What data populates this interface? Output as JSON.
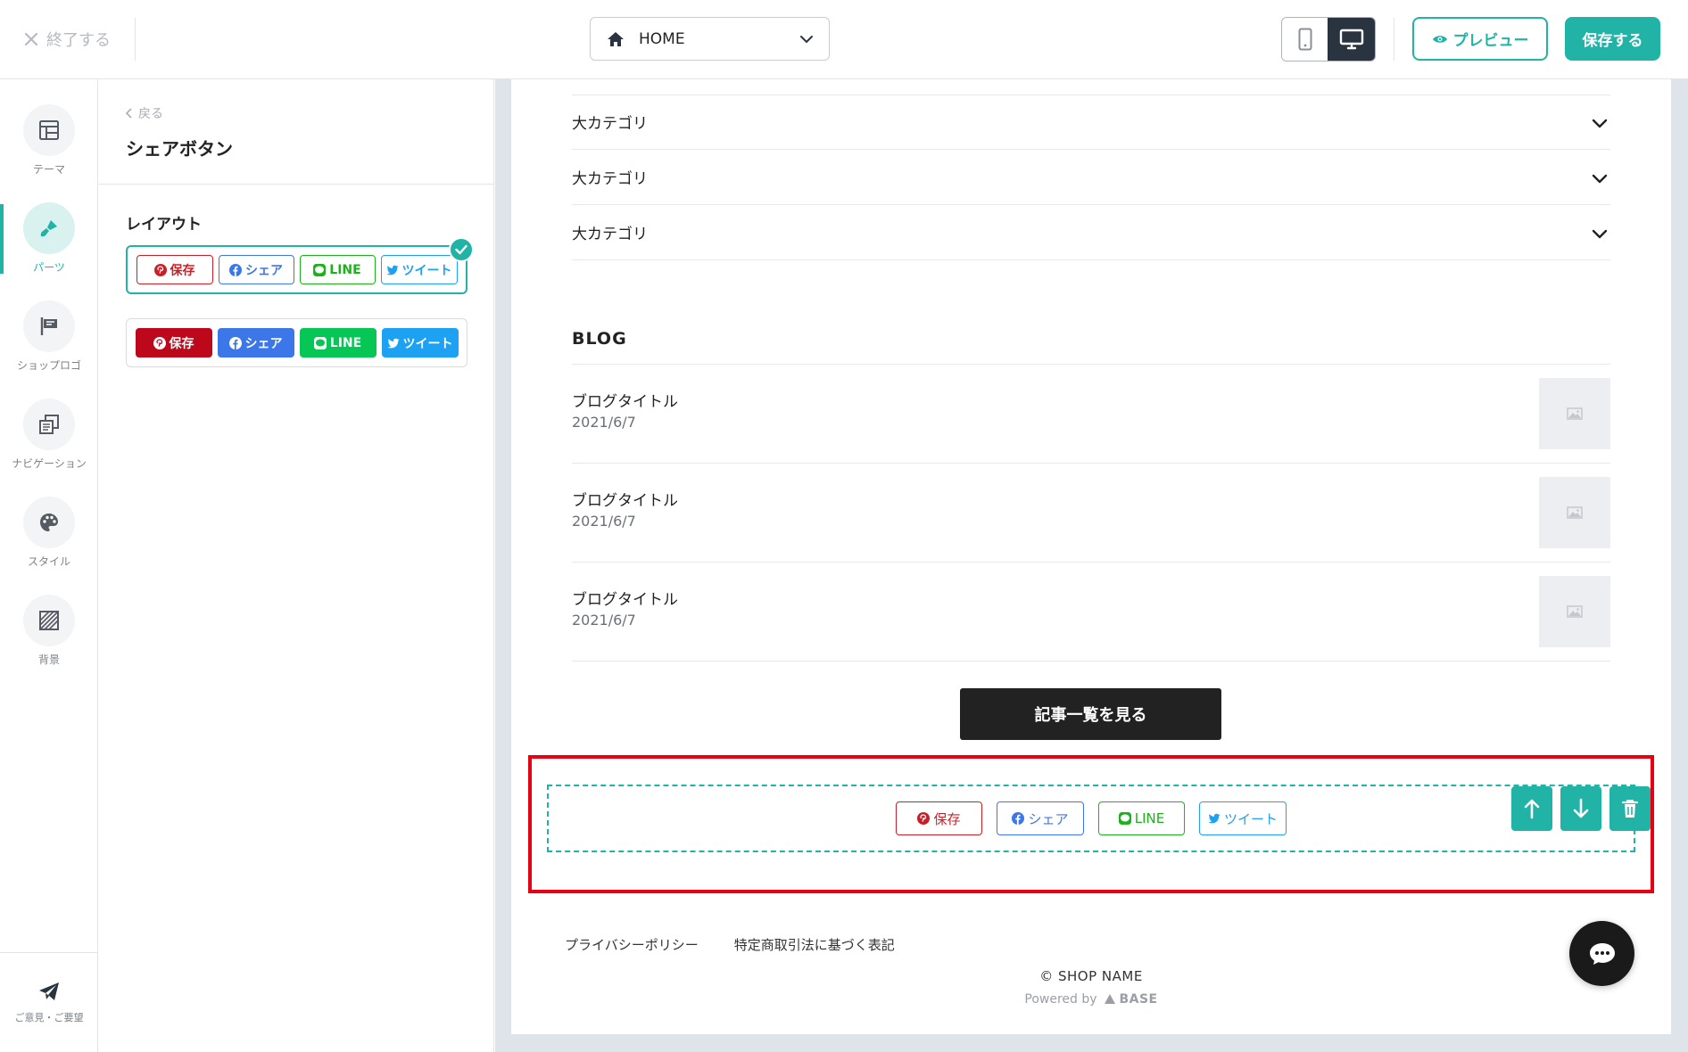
{
  "topbar": {
    "exit_label": "終了する",
    "page_select": "HOME",
    "preview_label": "プレビュー",
    "save_label": "保存する"
  },
  "sidebar": {
    "items": [
      {
        "label": "テーマ",
        "icon": "layout-icon"
      },
      {
        "label": "パーツ",
        "icon": "brush-icon",
        "active": true
      },
      {
        "label": "ショップロゴ",
        "icon": "flag-icon"
      },
      {
        "label": "ナビゲーション",
        "icon": "navigation-icon"
      },
      {
        "label": "スタイル",
        "icon": "palette-icon"
      },
      {
        "label": "背景",
        "icon": "pattern-icon"
      }
    ],
    "feedback_label": "ご意見・ご要望"
  },
  "panel": {
    "back_label": "戻る",
    "title": "シェアボタン",
    "layout_heading": "レイアウト",
    "share_labels": {
      "pinterest": "保存",
      "facebook": "シェア",
      "line": "LINE",
      "twitter": "ツイート"
    }
  },
  "canvas": {
    "categories": [
      "大カテゴリ",
      "大カテゴリ",
      "大カテゴリ"
    ],
    "blog_heading": "BLOG",
    "blog_posts": [
      {
        "title": "ブログタイトル",
        "date": "2021/6/7"
      },
      {
        "title": "ブログタイトル",
        "date": "2021/6/7"
      },
      {
        "title": "ブログタイトル",
        "date": "2021/6/7"
      }
    ],
    "view_all_label": "記事一覧を見る",
    "footer_links": [
      "プライバシーポリシー",
      "特定商取引法に基づく表記"
    ],
    "copyright": "© SHOP NAME",
    "powered_by": "Powered by",
    "powered_brand": "BASE"
  },
  "colors": {
    "accent": "#20b3a6",
    "pinterest": "#bd081c",
    "facebook": "#3b77e8",
    "line": "#06c755",
    "twitter": "#1da1f2",
    "highlight": "#e60012"
  }
}
